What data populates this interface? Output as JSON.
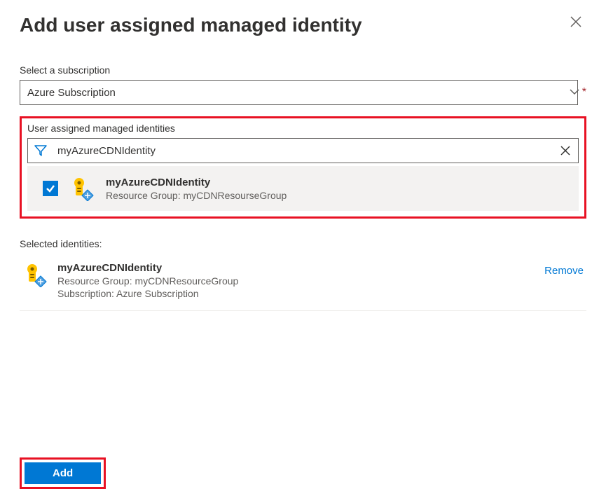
{
  "panel": {
    "title": "Add user assigned managed identity"
  },
  "subscription": {
    "label": "Select a subscription",
    "value": "Azure Subscription"
  },
  "identities": {
    "section_label": "User assigned managed identities",
    "filter_value": "myAzureCDNIdentity",
    "result": {
      "name": "myAzureCDNIdentity",
      "resource_group_line": "Resource Group: myCDNResourseGroup"
    }
  },
  "selected": {
    "label": "Selected identities:",
    "item": {
      "name": "myAzureCDNIdentity",
      "resource_group_line": "Resource Group: myCDNResourceGroup",
      "subscription_line": "Subscription: Azure Subscription"
    },
    "remove_label": "Remove"
  },
  "footer": {
    "add_label": "Add"
  }
}
